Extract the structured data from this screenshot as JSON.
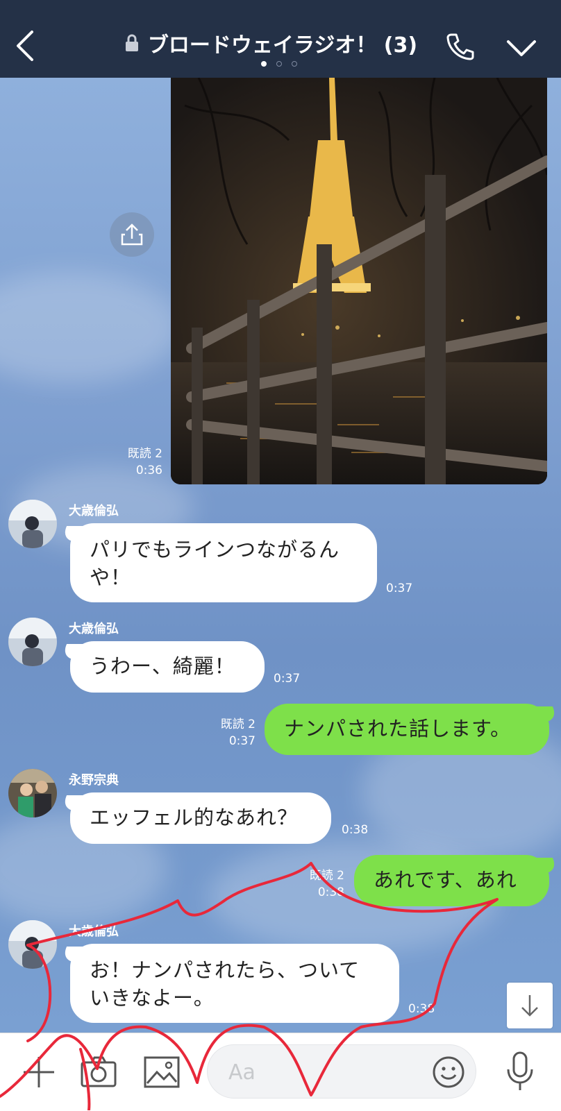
{
  "header": {
    "title": "ブロードウェイラジオ！ (3)",
    "icons": [
      "back-icon",
      "lock-icon",
      "phone-icon",
      "chevron-down-icon"
    ],
    "page_dots": 3,
    "active_dot": 1
  },
  "photo_message": {
    "read_label": "既読 2",
    "time": "0:36"
  },
  "messages": [
    {
      "side": "left",
      "sender": "大歳倫弘",
      "text_line1": "パリでもラインつながるん",
      "text_line2": "や！",
      "time": "0:37"
    },
    {
      "side": "left",
      "sender": "大歳倫弘",
      "text": "うわー、綺麗！",
      "time": "0:37"
    },
    {
      "side": "right",
      "read": "既読 2",
      "time": "0:37",
      "text": "ナンパされた話します。"
    },
    {
      "side": "left",
      "sender": "永野宗典",
      "text": "エッフェル的なあれ？",
      "time": "0:38"
    },
    {
      "side": "right",
      "read": "既読 2",
      "time": "0:38",
      "text": "あれです、あれ"
    },
    {
      "side": "left",
      "sender": "大歳倫弘",
      "text_line1": "お！ナンパされたら、ついて",
      "text_line2": "いきなよー。",
      "time": "0:38"
    }
  ],
  "input": {
    "placeholder": "Aa"
  },
  "colors": {
    "header_bg": "#243147",
    "bubble_mine": "#7ee04a",
    "bubble_other": "#ffffff",
    "chat_bg": "#7b9ccd",
    "annotation": "#e8283a"
  }
}
